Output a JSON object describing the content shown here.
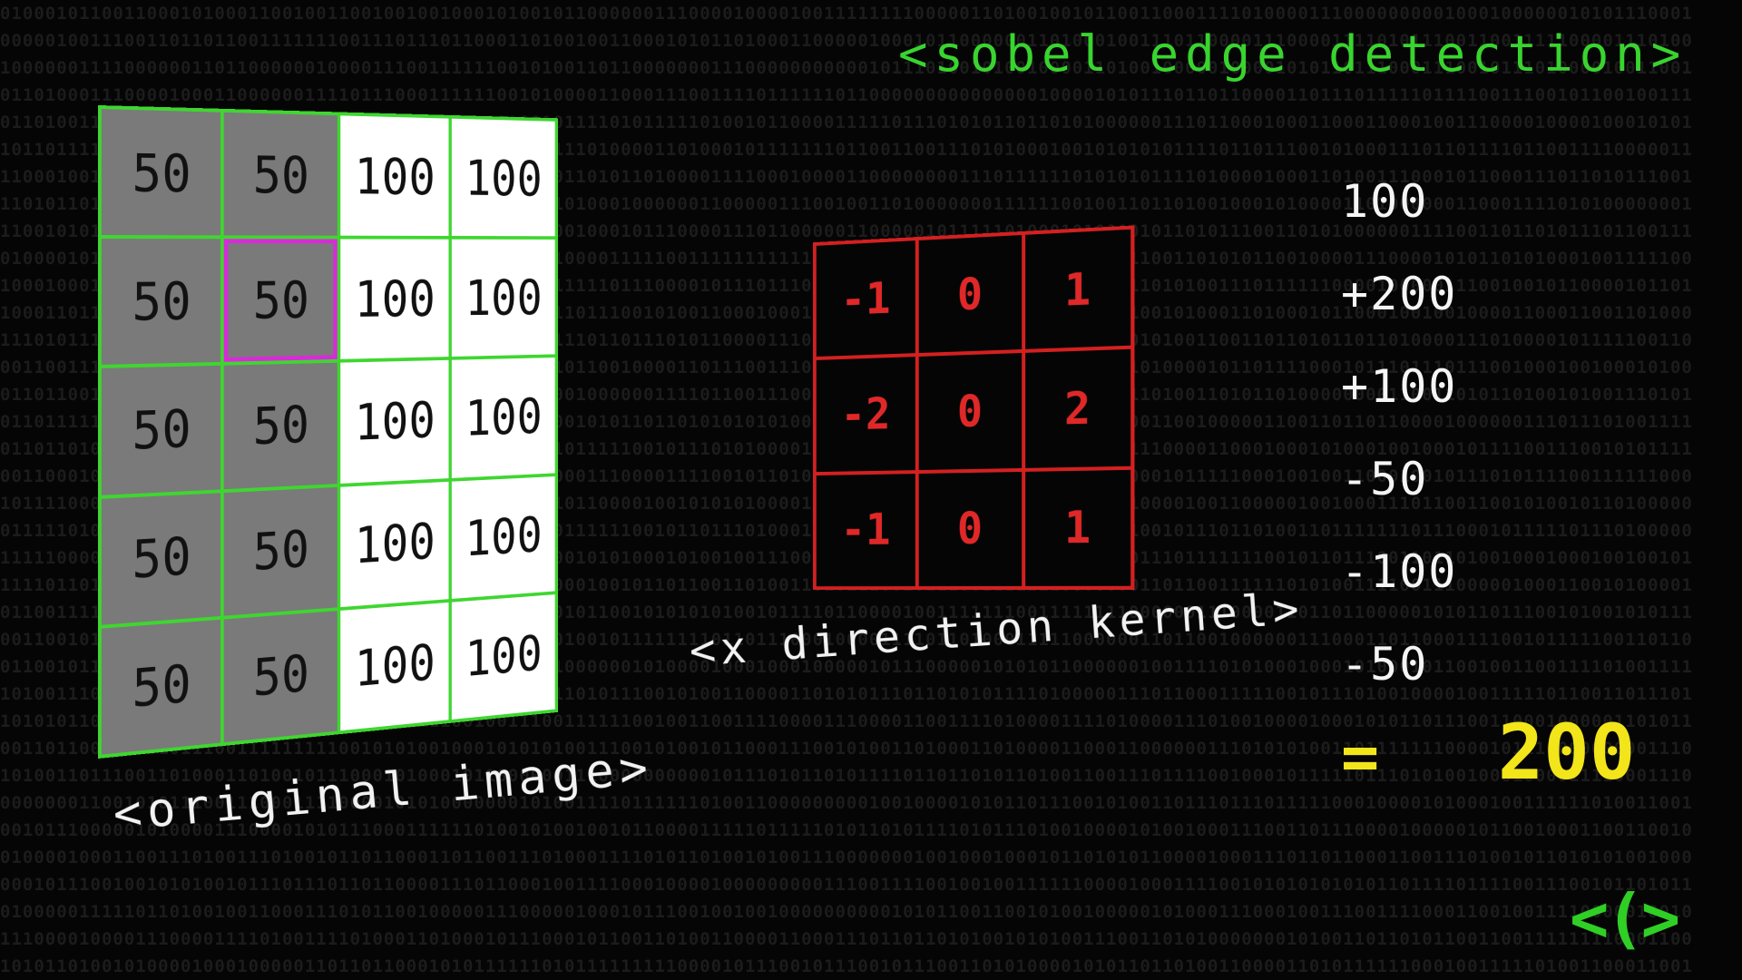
{
  "title": "<sobel edge detection>",
  "image": {
    "caption": "<original image>",
    "rows": [
      [
        "50",
        "50",
        "100",
        "100"
      ],
      [
        "50",
        "50",
        "100",
        "100"
      ],
      [
        "50",
        "50",
        "100",
        "100"
      ],
      [
        "50",
        "50",
        "100",
        "100"
      ],
      [
        "50",
        "50",
        "100",
        "100"
      ]
    ],
    "highlight_cell": {
      "row": 1,
      "col": 1
    }
  },
  "kernel": {
    "caption": "<x direction kernel>",
    "rows": [
      [
        "-1",
        "0",
        "1"
      ],
      [
        "-2",
        "0",
        "2"
      ],
      [
        "-1",
        "0",
        "1"
      ]
    ]
  },
  "terms": [
    "100",
    "+200",
    "+100",
    "-50",
    "-100",
    "-50"
  ],
  "result": {
    "equals": "=",
    "value": "200"
  },
  "logo": "<(>",
  "colors": {
    "grid_border": "#3fd630",
    "dark_pixel": "#7a7a7a",
    "light_pixel": "#ffffff",
    "highlight": "#d82bd8",
    "kernel": "#d42020",
    "title": "#39d42f",
    "result": "#f2e51a"
  }
}
